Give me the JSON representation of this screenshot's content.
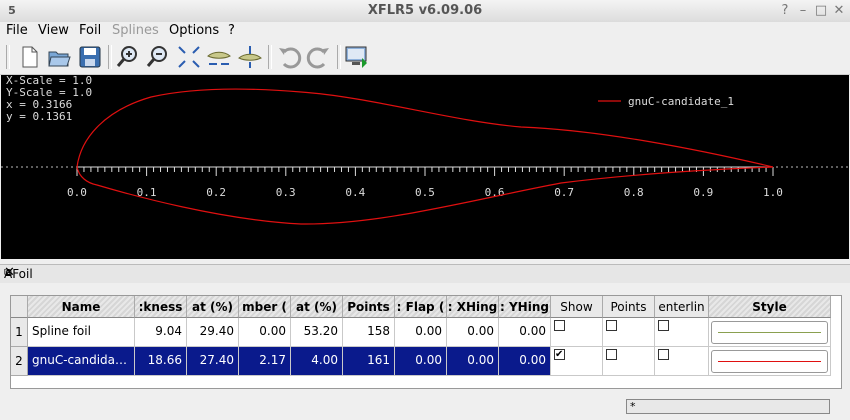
{
  "window": {
    "title": "XFLR5 v6.09.06",
    "app_icon": "5"
  },
  "menu": [
    "File",
    "View",
    "Foil",
    "Splines",
    "Options",
    "?"
  ],
  "menu_disabled": [
    false,
    false,
    false,
    true,
    false,
    false
  ],
  "toolbar_icons": [
    "new-file-icon",
    "open-folder-icon",
    "save-icon",
    "zoom-in-icon",
    "zoom-out-icon",
    "reset-view-icon",
    "reset-x-scale-icon",
    "reset-y-scale-icon",
    "undo-icon",
    "redo-icon",
    "store-foil-icon"
  ],
  "plot": {
    "info_lines": [
      "X-Scale =  1.0",
      "Y-Scale =  1.0",
      "x  =  0.3166",
      "y  =  0.1361"
    ],
    "legend_label": "gnuC-candidate_1",
    "x_ticks": [
      "0.0",
      "0.1",
      "0.2",
      "0.3",
      "0.4",
      "0.5",
      "0.6",
      "0.7",
      "0.8",
      "0.9",
      "1.0"
    ],
    "curve_color": "#e01010"
  },
  "dock": {
    "title": "AFoil"
  },
  "table": {
    "columns": [
      "Name",
      ":kness",
      "at (%)",
      "mber (",
      "at (%)",
      "Points",
      ": Flap (",
      ": XHing",
      ": YHing",
      "Show",
      "Points",
      "enterlin",
      "Style"
    ],
    "rows": [
      {
        "index": "1",
        "name": "Spline foil",
        "values": [
          "9.04",
          "29.40",
          "0.00",
          "53.20",
          "158",
          "0.00",
          "0.00",
          "0.00"
        ],
        "show": false,
        "points": false,
        "centerline": false,
        "style_color": "#8aa050",
        "selected": false
      },
      {
        "index": "2",
        "name": "gnuC-candida…",
        "values": [
          "18.66",
          "27.40",
          "2.17",
          "4.00",
          "161",
          "0.00",
          "0.00",
          "0.00"
        ],
        "show": true,
        "points": false,
        "centerline": false,
        "style_color": "#e01010",
        "selected": true
      }
    ]
  },
  "status": {
    "text": "*"
  }
}
